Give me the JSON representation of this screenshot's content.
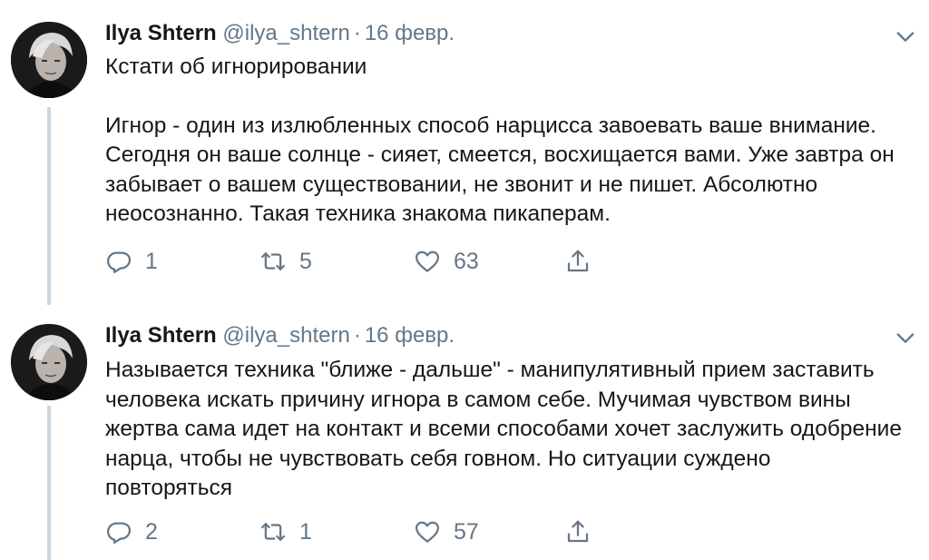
{
  "tweets": [
    {
      "name": "Ilya Shtern",
      "handle": "@ilya_shtern",
      "separator": "·",
      "date": "16 февр.",
      "paragraphs": [
        "Кстати об игнорировании",
        "Игнор - один из излюбленных способ нарцисса завоевать ваше внимание. Сегодня он ваше солнце - сияет, смеется, восхищается вами. Уже завтра он забывает о вашем существовании, не звонит и не пишет. Абсолютно неосознанно. Такая техника знакома пикаперам."
      ],
      "replies": "1",
      "retweets": "5",
      "likes": "63"
    },
    {
      "name": "Ilya Shtern",
      "handle": "@ilya_shtern",
      "separator": "·",
      "date": "16 февр.",
      "paragraphs": [
        "Называется техника \"ближе - дальше\" - манипулятивный прием заставить человека искать причину игнора в самом себе. Мучимая чувством вины жертва сама идет на контакт и всеми способами хочет заслужить одобрение нарца, чтобы не чувствовать себя говном. Но ситуации суждено повторяться"
      ],
      "replies": "2",
      "retweets": "1",
      "likes": "57"
    }
  ],
  "colors": {
    "text": "#14171a",
    "secondary": "#657786",
    "thread_line": "#ccd6dd",
    "background": "#ffffff"
  },
  "icons": [
    "reply-icon",
    "retweet-icon",
    "like-icon",
    "share-icon",
    "chevron-down-icon"
  ]
}
